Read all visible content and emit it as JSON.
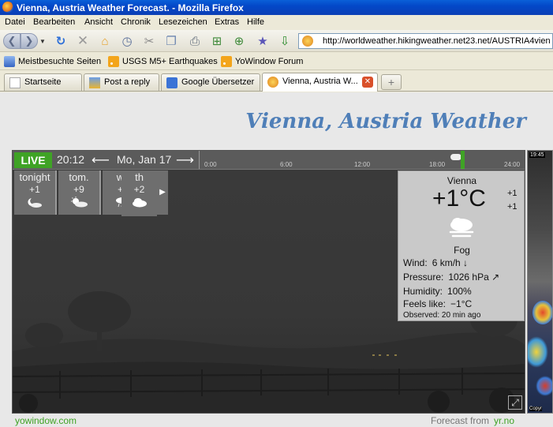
{
  "window": {
    "title": "Vienna, Austria Weather Forecast. - Mozilla Firefox"
  },
  "menu": [
    "Datei",
    "Bearbeiten",
    "Ansicht",
    "Chronik",
    "Lesezeichen",
    "Extras",
    "Hilfe"
  ],
  "nav": {
    "url": "http://worldweather.hikingweather.net23.net/AUSTRIA4vien"
  },
  "bookmarks": [
    "Meistbesuchte Seiten",
    "USGS M5+ Earthquakes",
    "YoWindow Forum"
  ],
  "tabs": [
    {
      "label": "Startseite"
    },
    {
      "label": "Post a reply"
    },
    {
      "label": "Google Übersetzer"
    },
    {
      "label": "Vienna, Austria W..."
    }
  ],
  "page": {
    "heading": "Vienna, Austria Weather"
  },
  "widget": {
    "live": "LIVE",
    "time": "20:12",
    "date": "Mo, Jan 17",
    "timeline_ticks": [
      "0:00",
      "6:00",
      "12:00",
      "18:00",
      "24:00"
    ],
    "forecast": [
      {
        "day": "tonight",
        "temp": "+1",
        "icon": "moon-cloud-icon"
      },
      {
        "day": "tom.",
        "temp": "+9",
        "icon": "sun-cloud-icon"
      },
      {
        "day": "we",
        "temp": "+7",
        "icon": "rain-cloud-icon"
      },
      {
        "day": "th",
        "temp": "+2",
        "icon": "cloud-icon"
      }
    ],
    "current": {
      "city": "Vienna",
      "temp": "+1°C",
      "hi": "+1",
      "lo": "+1",
      "condition": "Fog",
      "wind_label": "Wind:",
      "wind_value": "6 km/h ↓",
      "pressure_label": "Pressure:",
      "pressure_value": "1026 hPa ↗",
      "humidity_label": "Humidity:",
      "humidity_value": "100%",
      "feels_label": "Feels like:",
      "feels_value": "−1°C",
      "observed": "Observed:  20 min ago"
    },
    "footer_left": "yowindow.com",
    "footer_right_label": "Forecast from",
    "footer_right_source": "yr.no"
  },
  "radar": {
    "time": "19:45",
    "copyright": "Copyr"
  }
}
